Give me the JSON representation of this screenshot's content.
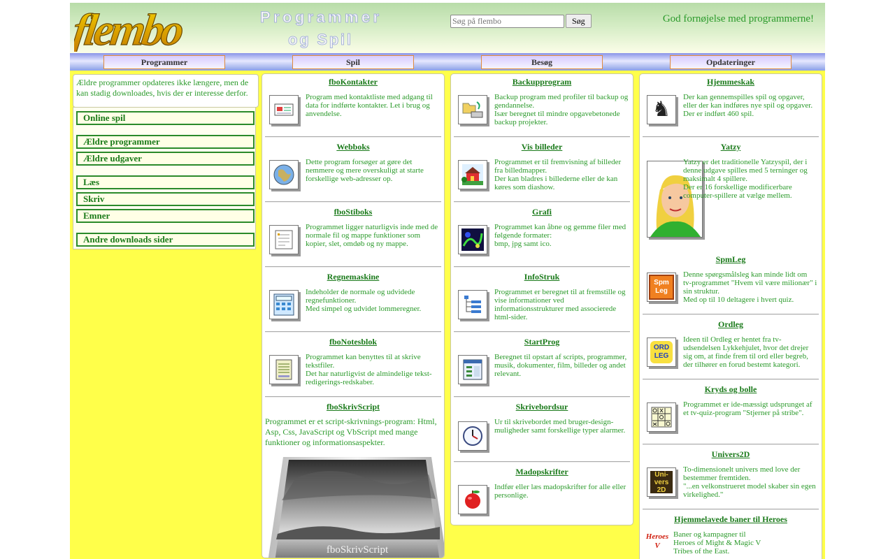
{
  "header": {
    "logo_text": "flembo",
    "banner_line1": "Programmer",
    "banner_line2": "og Spil",
    "search_placeholder": "Søg på flembo",
    "search_button": "Søg",
    "tagline": "God fornøjelse med programmerne!"
  },
  "nav": [
    "Programmer",
    "Spil",
    "Besøg",
    "Opdateringer"
  ],
  "sidebar": {
    "notice": "Ældre programmer opdateres ikke længere, men de kan stadig downloades, hvis der er interesse derfor.",
    "items": [
      "Online spil",
      "Ældre programmer",
      "Ældre udgaver",
      "Læs",
      "Skriv",
      "Emner",
      "Andre downloads sider"
    ]
  },
  "col1": [
    {
      "title": "fboKontakter",
      "text": "Program med kontaktliste med adgang til data for indførte kontakter. Let i brug og anvendelse.",
      "icon": "contact-card-icon"
    },
    {
      "title": "Webboks",
      "text": "Dette program forsøger at gøre det nemmere og mere overskuligt at starte forskellige web-adresser op.",
      "icon": "globe-icon"
    },
    {
      "title": "fboStiboks",
      "text": "Programmet ligger naturligvis inde med de normale fil og mappe funktioner som kopier, slet, omdøb og ny mappe.",
      "icon": "file-list-icon"
    },
    {
      "title": "Regnemaskine",
      "text": "Indeholder de normale og udvidede regnefunktioner.\nMed simpel og udvidet lommeregner.",
      "icon": "calculator-icon"
    },
    {
      "title": "fboNotesblok",
      "text": "Programmet kan benyttes til at skrive tekstfiler.\nDet har naturligvist de almindelige tekst-redigerings-redskaber.",
      "icon": "notepad-icon"
    },
    {
      "title": "fboSkrivScript",
      "text": "Programmet er et script-skrivnings-program: Html, Asp, Css, JavaScript og VbScript med mange funktioner og informationsaspekter.",
      "photo_caption": "fboSkrivScript"
    }
  ],
  "col2": [
    {
      "title": "Backupprogram",
      "text": "Backup program med profiler til backup og gendannelse.\nIsær beregnet til mindre opgavebetonede backup projekter.",
      "icon": "backup-icon"
    },
    {
      "title": "Vis billeder",
      "text": "Programmet er til fremvisning af billeder fra billedmapper.\nDer kan bladres i billederne eller de kan køres som diashow.",
      "icon": "picture-house-icon"
    },
    {
      "title": "Grafi",
      "text": "Programmet kan åbne og gemme filer med følgende formater:\nbmp, jpg samt ico.",
      "icon": "graphics-icon"
    },
    {
      "title": "InfoStruk",
      "text": "Programmet er beregnet til at fremstille og vise informationer ved informationsstrukturer med associerede html-sider.",
      "icon": "tree-structure-icon"
    },
    {
      "title": "StartProg",
      "text": "Beregnet til opstart af scripts, programmer, musik, dokumenter, film, billeder og andet relevant.",
      "icon": "launcher-icon"
    },
    {
      "title": "Skrivebordsur",
      "text": "Ur til skrivebordet med bruger-design-muligheder samt forskellige typer alarmer.",
      "icon": "clock-icon"
    },
    {
      "title": "Madopskrifter",
      "text": "Indfør eller læs madopskrifter for alle eller personlige.",
      "icon": "apple-icon"
    }
  ],
  "col3": [
    {
      "title": "Hjemmeskak",
      "text": "Der kan gennemspilles spil og opgaver, eller der kan indføres nye spil og opgaver.\nDer er indført 460 spil.",
      "icon": "chess-knight-icon"
    },
    {
      "title": "Yatzy",
      "text": "Yatzy er det traditionelle Yatzyspil, der i denne udgave spilles med 5 terninger og maksimalt 4 spillere.\nDer er 16 forskellige modificerbare computer-spillere at vælge mellem.",
      "icon": "player-portrait-icon"
    },
    {
      "title": "SpmLeg",
      "text": "Denne spørgsmålsleg kan minde lidt om tv-programmet \"Hvem vil være milionær\" i sin struktur.\nMed op til 10 deltagere i hvert quiz.",
      "icon": "spmleg-icon",
      "icon_label": "Spm Leg"
    },
    {
      "title": "Ordleg",
      "text": "Ideen til Ordleg er hentet fra tv-udsendelsen Lykkehjulet, hvor det drejer sig om, at finde frem til ord eller begreb, der tilhører en forud bestemt kategori.",
      "icon": "ordleg-icon",
      "icon_label": "ORD LEG"
    },
    {
      "title": "Kryds og bolle",
      "text": "Programmet er ide-mæssigt udsprunget af et tv-quiz-program \"Stjerner på stribe\".",
      "icon": "tictactoe-icon"
    },
    {
      "title": "Univers2D",
      "text": "To-dimensionelt univers med love der bestemmer fremtiden.\n\"...en velkonstrueret model skaber sin egen virkelighed.\"",
      "icon": "univers2d-icon",
      "icon_label": "Uni-vers 2D"
    },
    {
      "title": "Hjemmelavede baner til Heroes",
      "text": "Baner og kampagner til\nHeroes of Might & Magic V\nTribes of the East.",
      "icon": "heroes-logo-icon",
      "icon_label": "Heroes V"
    }
  ]
}
